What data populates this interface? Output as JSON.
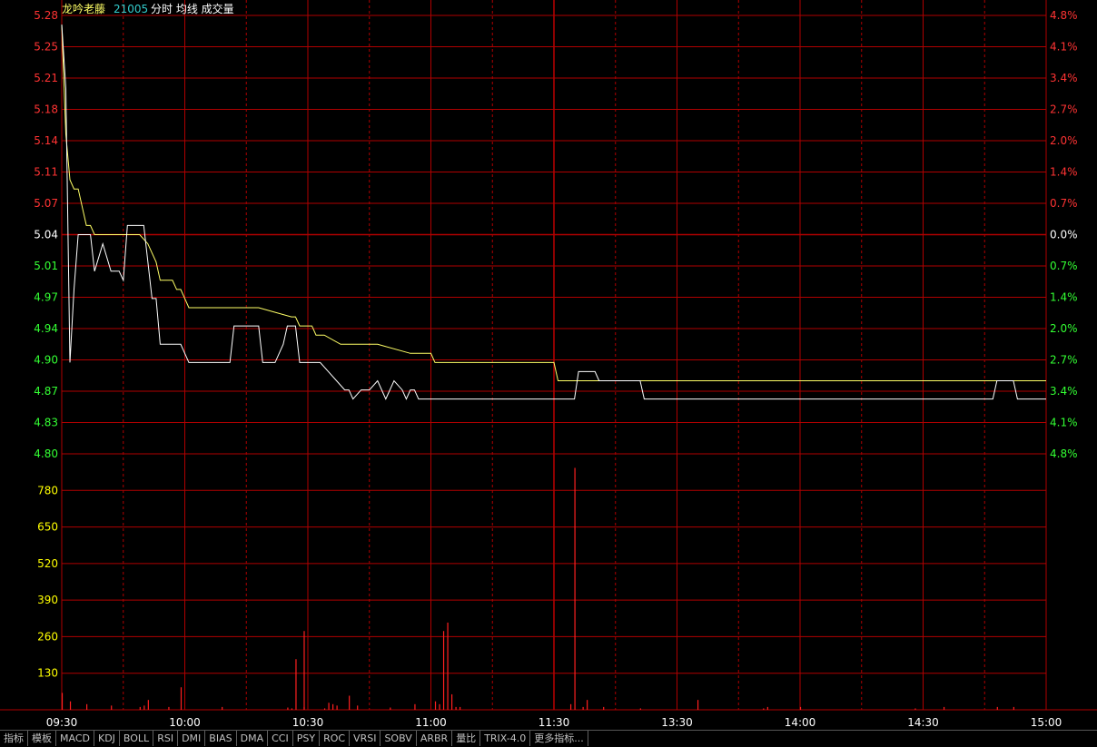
{
  "header": {
    "stock_name": "龙吟老藤",
    "code": "21005",
    "indicators": "分时 均线 成交量"
  },
  "colors": {
    "background": "#000000",
    "grid": "#b00000",
    "price_line": "#ffffff",
    "avg_line": "#ffff66",
    "up": "#ff3333",
    "down": "#33ff33",
    "neutral": "#ffffff",
    "volume_bar": "#ff2020",
    "volume_axis": "#ffff00",
    "time_label": "#ffffff"
  },
  "price_axis": {
    "left_labels": [
      "5.28",
      "5.25",
      "5.21",
      "5.18",
      "5.14",
      "5.11",
      "5.07",
      "5.04",
      "5.01",
      "4.97",
      "4.94",
      "4.90",
      "4.87",
      "4.83",
      "4.80"
    ],
    "right_labels": [
      "4.8%",
      "4.1%",
      "3.4%",
      "2.7%",
      "2.0%",
      "1.4%",
      "0.7%",
      "0.0%",
      "0.7%",
      "1.4%",
      "2.0%",
      "2.7%",
      "3.4%",
      "4.1%",
      "4.8%"
    ],
    "prev_close": 5.04,
    "ylim": [
      4.8,
      5.28
    ]
  },
  "volume_axis": {
    "labels": [
      "780",
      "650",
      "520",
      "390",
      "260",
      "130"
    ],
    "ylim": [
      0,
      910
    ]
  },
  "time_axis": {
    "labels": [
      "09:30",
      "10:00",
      "10:30",
      "11:00",
      "11:30",
      "13:30",
      "14:00",
      "14:30",
      "15:00"
    ]
  },
  "chart_data": {
    "type": "line",
    "x_unit": "trading minute index (0=09:30, 120=11:30/13:00, 240=15:00)",
    "series": [
      {
        "points": [
          [
            0,
            5.27
          ],
          [
            1,
            5.2
          ],
          [
            2,
            4.9
          ],
          [
            3,
            4.98
          ],
          [
            4,
            5.04
          ],
          [
            7,
            5.04
          ],
          [
            8,
            5.0
          ],
          [
            10,
            5.03
          ],
          [
            12,
            5.0
          ],
          [
            14,
            5.0
          ],
          [
            15,
            4.99
          ],
          [
            16,
            5.05
          ],
          [
            20,
            5.05
          ],
          [
            22,
            4.97
          ],
          [
            23,
            4.97
          ],
          [
            24,
            4.92
          ],
          [
            29,
            4.92
          ],
          [
            31,
            4.9
          ],
          [
            36,
            4.9
          ],
          [
            37,
            4.9
          ],
          [
            41,
            4.9
          ],
          [
            42,
            4.94
          ],
          [
            48,
            4.94
          ],
          [
            49,
            4.9
          ],
          [
            52,
            4.9
          ],
          [
            54,
            4.92
          ],
          [
            55,
            4.94
          ],
          [
            57,
            4.94
          ],
          [
            58,
            4.9
          ],
          [
            62,
            4.9
          ],
          [
            63,
            4.9
          ],
          [
            65,
            4.89
          ],
          [
            67,
            4.88
          ],
          [
            69,
            4.87
          ],
          [
            70,
            4.87
          ],
          [
            71,
            4.86
          ],
          [
            73,
            4.87
          ],
          [
            75,
            4.87
          ],
          [
            77,
            4.88
          ],
          [
            79,
            4.86
          ],
          [
            81,
            4.88
          ],
          [
            83,
            4.87
          ],
          [
            84,
            4.86
          ],
          [
            85,
            4.87
          ],
          [
            86,
            4.87
          ],
          [
            87,
            4.86
          ],
          [
            100,
            4.86
          ],
          [
            100,
            4.86
          ],
          [
            124,
            4.86
          ],
          [
            125,
            4.86
          ],
          [
            126,
            4.89
          ],
          [
            130,
            4.89
          ],
          [
            131,
            4.88
          ],
          [
            141,
            4.88
          ],
          [
            142,
            4.86
          ],
          [
            200,
            4.86
          ],
          [
            227,
            4.86
          ],
          [
            228,
            4.88
          ],
          [
            232,
            4.88
          ],
          [
            233,
            4.86
          ],
          [
            240,
            4.86
          ]
        ]
      },
      {
        "points": [
          [
            0,
            5.27
          ],
          [
            1,
            5.15
          ],
          [
            2,
            5.1
          ],
          [
            3,
            5.09
          ],
          [
            4,
            5.09
          ],
          [
            5,
            5.07
          ],
          [
            6,
            5.05
          ],
          [
            7,
            5.05
          ],
          [
            8,
            5.04
          ],
          [
            15,
            5.04
          ],
          [
            19,
            5.04
          ],
          [
            21,
            5.03
          ],
          [
            23,
            5.01
          ],
          [
            24,
            4.99
          ],
          [
            26,
            4.99
          ],
          [
            27,
            4.99
          ],
          [
            28,
            4.98
          ],
          [
            29,
            4.98
          ],
          [
            30,
            4.97
          ],
          [
            31,
            4.96
          ],
          [
            33,
            4.96
          ],
          [
            36,
            4.96
          ],
          [
            40,
            4.96
          ],
          [
            48,
            4.96
          ],
          [
            56,
            4.95
          ],
          [
            57,
            4.95
          ],
          [
            58,
            4.94
          ],
          [
            61,
            4.94
          ],
          [
            62,
            4.93
          ],
          [
            63,
            4.93
          ],
          [
            64,
            4.93
          ],
          [
            68,
            4.92
          ],
          [
            72,
            4.92
          ],
          [
            77,
            4.92
          ],
          [
            85,
            4.91
          ],
          [
            90,
            4.91
          ],
          [
            91,
            4.9
          ],
          [
            92,
            4.9
          ],
          [
            96,
            4.9
          ],
          [
            100,
            4.9
          ],
          [
            120,
            4.9
          ],
          [
            121,
            4.88
          ],
          [
            140,
            4.88
          ],
          [
            170,
            4.88
          ],
          [
            240,
            4.88
          ]
        ]
      }
    ],
    "volume_bars": [
      [
        0,
        60
      ],
      [
        2,
        30
      ],
      [
        6,
        20
      ],
      [
        12,
        15
      ],
      [
        19,
        10
      ],
      [
        20,
        15
      ],
      [
        21,
        35
      ],
      [
        26,
        10
      ],
      [
        29,
        80
      ],
      [
        39,
        10
      ],
      [
        55,
        8
      ],
      [
        56,
        5
      ],
      [
        57,
        180
      ],
      [
        59,
        280
      ],
      [
        59,
        10
      ],
      [
        64,
        5
      ],
      [
        65,
        25
      ],
      [
        66,
        20
      ],
      [
        67,
        15
      ],
      [
        70,
        50
      ],
      [
        72,
        15
      ],
      [
        80,
        8
      ],
      [
        86,
        20
      ],
      [
        91,
        30
      ],
      [
        92,
        20
      ],
      [
        93,
        280
      ],
      [
        94,
        310
      ],
      [
        95,
        55
      ],
      [
        96,
        10
      ],
      [
        97,
        10
      ],
      [
        124,
        20
      ],
      [
        125,
        860
      ],
      [
        127,
        10
      ],
      [
        128,
        35
      ],
      [
        132,
        10
      ],
      [
        141,
        5
      ],
      [
        155,
        35
      ],
      [
        171,
        5
      ],
      [
        172,
        10
      ],
      [
        180,
        10
      ],
      [
        208,
        5
      ],
      [
        215,
        10
      ],
      [
        228,
        10
      ],
      [
        232,
        10
      ]
    ]
  },
  "tabs": [
    {
      "label": "指标",
      "active": false
    },
    {
      "label": "模板",
      "active": false
    },
    {
      "label": "MACD",
      "active": false
    },
    {
      "label": "KDJ",
      "active": false
    },
    {
      "label": "BOLL",
      "active": false
    },
    {
      "label": "RSI",
      "active": false
    },
    {
      "label": "DMI",
      "active": false
    },
    {
      "label": "BIAS",
      "active": false
    },
    {
      "label": "DMA",
      "active": false
    },
    {
      "label": "CCI",
      "active": false
    },
    {
      "label": "PSY",
      "active": false
    },
    {
      "label": "ROC",
      "active": false
    },
    {
      "label": "VRSI",
      "active": false
    },
    {
      "label": "SOBV",
      "active": false
    },
    {
      "label": "ARBR",
      "active": false
    },
    {
      "label": "量比",
      "active": false
    },
    {
      "label": "TRIX-4.0",
      "active": false
    },
    {
      "label": "更多指标...",
      "active": false
    }
  ]
}
